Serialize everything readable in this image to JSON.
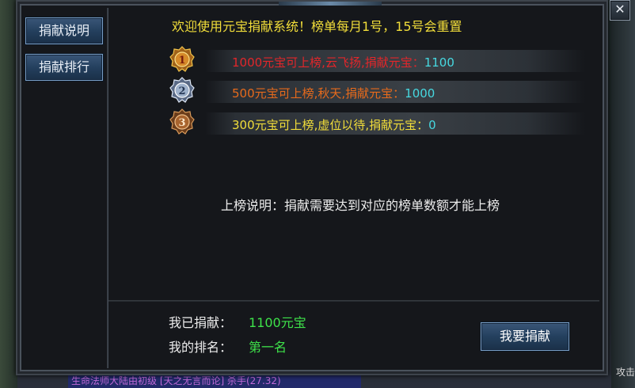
{
  "sidebar": {
    "items": [
      {
        "label": "捐献说明"
      },
      {
        "label": "捐献排行"
      }
    ]
  },
  "header": {
    "welcome": "欢迎使用元宝捐献系统！榜单每月1号，15号会重置"
  },
  "ranks": [
    {
      "badge": "rank-1-medal-icon",
      "label": "1000元宝可上榜,云飞扬,捐献元宝：",
      "value": "1100",
      "color": "#e2262a"
    },
    {
      "badge": "rank-2-medal-icon",
      "label": "500元宝可上榜,秋天,捐献元宝：",
      "value": "1000",
      "color": "#e66a1c"
    },
    {
      "badge": "rank-3-medal-icon",
      "label": "300元宝可上榜,虚位以待,捐献元宝：",
      "value": "0",
      "color": "#f2de3a"
    }
  ],
  "note": "上榜说明：捐献需要达到对应的榜单数额才能上榜",
  "footer": {
    "donated_label": "我已捐献：",
    "donated_value": "1100元宝",
    "rank_label": "我的排名：",
    "rank_value": "第一名",
    "donate_button": "我要捐献"
  },
  "close_icon": "close-icon",
  "background": {
    "attack_label": "攻击",
    "chat_line": "生命法师大陆由初级 [天之无言而论] 杀手(27.32)"
  },
  "colors": {
    "accent_yellow": "#f2de3a",
    "value_cyan": "#46d8e0",
    "value_green": "#3ee24a",
    "button_blue": "#24405e"
  }
}
